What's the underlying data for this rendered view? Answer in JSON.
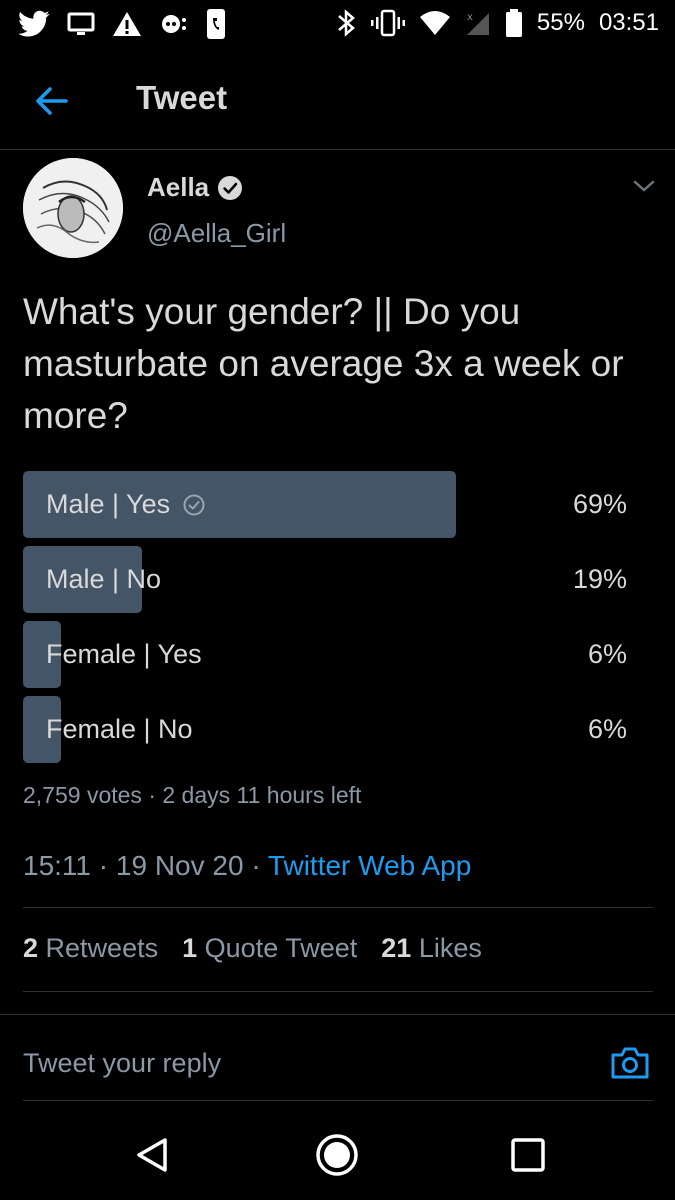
{
  "status_bar": {
    "battery_percent": "55%",
    "time": "03:51",
    "left_icons": [
      "twitter-icon",
      "screen-icon",
      "warning-icon",
      "voicemail-icon",
      "phone-icon"
    ],
    "right_icons": [
      "bluetooth-icon",
      "vibrate-icon",
      "wifi-icon",
      "signal-icon",
      "battery-icon"
    ]
  },
  "header": {
    "title": "Tweet"
  },
  "tweet": {
    "author_name": "Aella",
    "author_handle": "@Aella_Girl",
    "text": "What's your gender? || Do you masturbate on average 3x a week or more?",
    "poll": {
      "options": [
        {
          "label": "Male | Yes",
          "percent": "69%",
          "value": 69,
          "selected": true
        },
        {
          "label": "Male | No",
          "percent": "19%",
          "value": 19,
          "selected": false
        },
        {
          "label": "Female | Yes",
          "percent": "6%",
          "value": 6,
          "selected": false
        },
        {
          "label": "Female | No",
          "percent": "6%",
          "value": 6,
          "selected": false
        }
      ],
      "votes": "2,759 votes",
      "separator": "·",
      "time_left": "2 days 11 hours left"
    },
    "time": "15:11",
    "date": "19 Nov 20",
    "source": "Twitter Web App",
    "retweets_count": "2",
    "retweets_label": "Retweets",
    "quotes_count": "1",
    "quotes_label": "Quote Tweet",
    "likes_count": "21",
    "likes_label": "Likes"
  },
  "reply": {
    "placeholder": "Tweet your reply"
  },
  "colors": {
    "background": "#000000",
    "poll_bar": "#435566",
    "link": "#1d9bf0",
    "secondary_text": "#8b98a5"
  }
}
